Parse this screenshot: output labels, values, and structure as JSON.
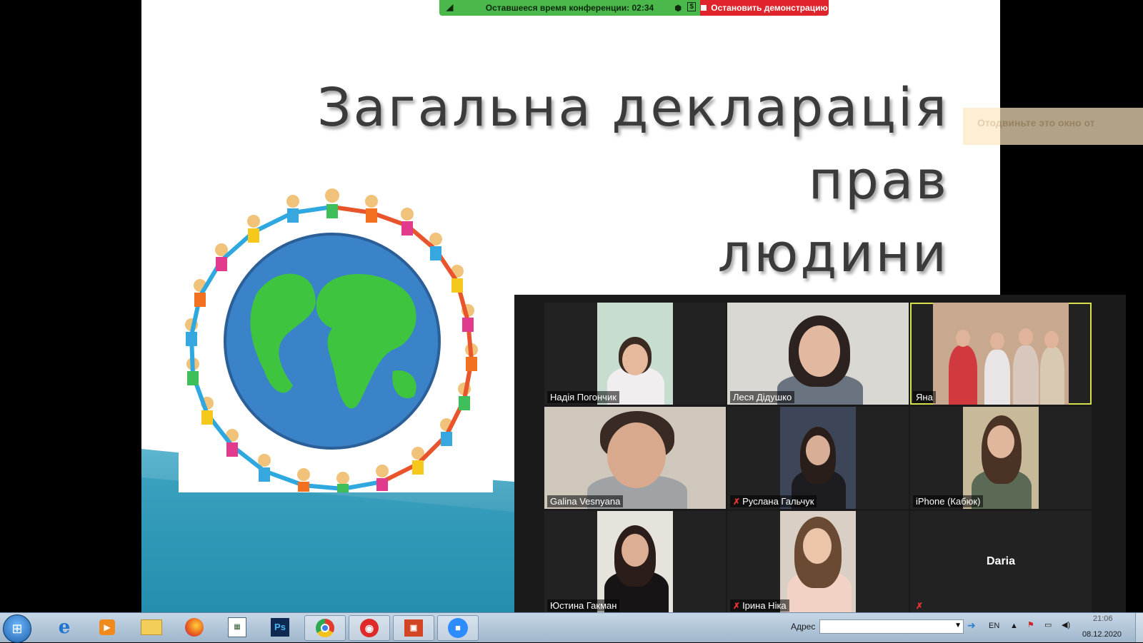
{
  "slide": {
    "title_line1": "Загальна декларація прав",
    "title_line2": "людини"
  },
  "conference_bar": {
    "timer_label": "Оставшееся время конференции: 02:34",
    "stop_label": "Остановить демонстрацию",
    "timer_color": "#4bb84b",
    "stop_color": "#e0242b"
  },
  "ghost_tooltip": {
    "text": "Отодвиньте это окно от"
  },
  "participants": [
    {
      "name": "Надія Погончик",
      "muted": false,
      "active": false
    },
    {
      "name": "Леся Дідушко",
      "muted": false,
      "active": false
    },
    {
      "name": "Яна",
      "muted": false,
      "active": true
    },
    {
      "name": "Galina  Vesnyana",
      "muted": false,
      "active": false
    },
    {
      "name": "Руслана Гальчук",
      "muted": true,
      "active": false
    },
    {
      "name": "iPhone (Кабюк)",
      "muted": false,
      "active": false
    },
    {
      "name": "Юстина Гакман",
      "muted": false,
      "active": false
    },
    {
      "name": "Ірина Ніка",
      "muted": true,
      "active": false
    },
    {
      "name": "Daria",
      "muted": true,
      "active": false
    }
  ],
  "taskbar": {
    "apps": [
      "start-orb",
      "internet-explorer-icon",
      "media-player-icon",
      "file-explorer-icon",
      "firefox-icon",
      "spreadsheet-icon",
      "photoshop-icon",
      "chrome-icon",
      "recorder-icon",
      "powerpoint-icon",
      "zoom-icon"
    ],
    "address_label": "Адрес",
    "language": "EN",
    "time": "21:06",
    "date": "08.12.2020"
  }
}
